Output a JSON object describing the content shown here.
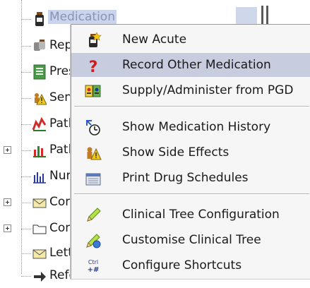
{
  "tree": {
    "items": [
      {
        "label": "Medication",
        "icon": "medication-bottle-icon",
        "expander": false,
        "selected": true
      },
      {
        "label": "Rep",
        "icon": "repeat-pills-icon",
        "expander": false
      },
      {
        "label": "Pres",
        "icon": "prescription-icon",
        "expander": false
      },
      {
        "label": "Sen",
        "icon": "warning-people-icon",
        "expander": false
      },
      {
        "label": "Patl",
        "icon": "pathology-chart-icon",
        "expander": false
      },
      {
        "label": "Patl",
        "icon": "pathology-chart-icon",
        "expander": true
      },
      {
        "label": "Nun",
        "icon": "numeric-chart-icon",
        "expander": false
      },
      {
        "label": "Con",
        "icon": "envelope-icon",
        "expander": true
      },
      {
        "label": "Con",
        "icon": "folder-icon",
        "expander": true
      },
      {
        "label": "Lett",
        "icon": "envelope-icon",
        "expander": false
      },
      {
        "label": "Refe",
        "icon": "referral-icon",
        "expander": false
      }
    ]
  },
  "context_menu": {
    "items": [
      {
        "label": "New Acute",
        "icon": "new-acute-icon"
      },
      {
        "label": "Record Other Medication",
        "icon": "question-mark-icon",
        "highlighted": true
      },
      {
        "label": "Supply/Administer from PGD",
        "icon": "supply-pgd-icon"
      },
      {
        "label": "Show Medication History",
        "icon": "history-clock-icon"
      },
      {
        "label": "Show Side Effects",
        "icon": "side-effects-icon"
      },
      {
        "label": "Print Drug Schedules",
        "icon": "print-schedule-icon"
      },
      {
        "label": "Clinical Tree Configuration",
        "icon": "pencil-icon"
      },
      {
        "label": "Customise Clinical Tree",
        "icon": "customise-tree-icon"
      },
      {
        "label": "Configure Shortcuts",
        "icon": "ctrl-shortcut-icon",
        "icon_text": "Ctrl\n+#"
      }
    ]
  },
  "colors": {
    "highlight": "#c8ccdf",
    "selected_tree": "#c9d5ee",
    "menu_bg": "#f6f6f6"
  }
}
